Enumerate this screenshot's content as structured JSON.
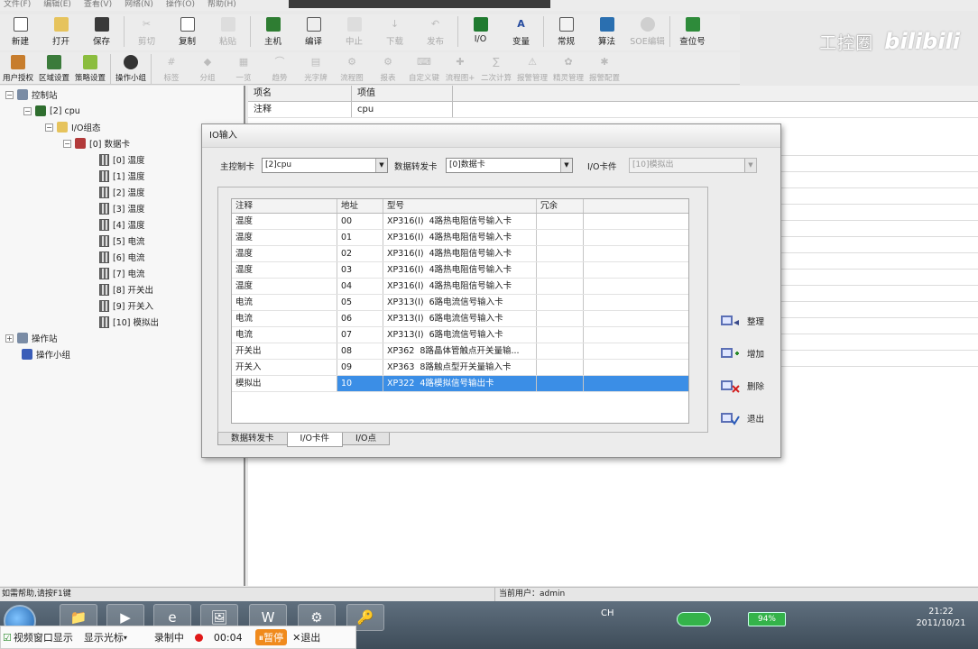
{
  "menubar": {
    "items": [
      "文件(F)",
      "编辑(E)",
      "查看(V)",
      "网络(N)",
      "操作(O)",
      "帮助(H)"
    ]
  },
  "toolbar1": [
    {
      "label": "新建",
      "icon": "new-file-icon",
      "enabled": true
    },
    {
      "label": "打开",
      "icon": "open-folder-icon",
      "enabled": true
    },
    {
      "label": "保存",
      "icon": "save-icon",
      "enabled": true
    },
    {
      "label": "剪切",
      "icon": "cut-icon",
      "enabled": false
    },
    {
      "label": "复制",
      "icon": "copy-icon",
      "enabled": true
    },
    {
      "label": "粘贴",
      "icon": "paste-icon",
      "enabled": false
    },
    {
      "label": "主机",
      "icon": "host-icon",
      "enabled": true
    },
    {
      "label": "编译",
      "icon": "compile-icon",
      "enabled": true
    },
    {
      "label": "中止",
      "icon": "stop-icon",
      "enabled": false
    },
    {
      "label": "下载",
      "icon": "download-icon",
      "enabled": false
    },
    {
      "label": "发布",
      "icon": "publish-icon",
      "enabled": false
    },
    {
      "label": "I/O",
      "icon": "io-icon",
      "enabled": true
    },
    {
      "label": "变量",
      "icon": "variable-icon",
      "enabled": true
    },
    {
      "label": "常规",
      "icon": "general-icon",
      "enabled": true
    },
    {
      "label": "算法",
      "icon": "algorithm-icon",
      "enabled": true
    },
    {
      "label": "SOE编辑",
      "icon": "soe-icon",
      "enabled": false
    },
    {
      "label": "查位号",
      "icon": "find-tag-icon",
      "enabled": true
    }
  ],
  "toolbar2": [
    {
      "label": "用户授权",
      "icon": "user-auth-icon",
      "enabled": true
    },
    {
      "label": "区域设置",
      "icon": "region-icon",
      "enabled": true
    },
    {
      "label": "策略设置",
      "icon": "policy-icon",
      "enabled": true
    },
    {
      "label": "操作小组",
      "icon": "operator-group-icon",
      "enabled": true
    },
    {
      "label": "标签",
      "icon": "tag-icon",
      "enabled": false
    },
    {
      "label": "分组",
      "icon": "group-icon",
      "enabled": false
    },
    {
      "label": "一览",
      "icon": "overview-icon",
      "enabled": false
    },
    {
      "label": "趋势",
      "icon": "trend-icon",
      "enabled": false
    },
    {
      "label": "光字牌",
      "icon": "annunciator-icon",
      "enabled": false
    },
    {
      "label": "流程图",
      "icon": "flowchart-icon",
      "enabled": false
    },
    {
      "label": "报表",
      "icon": "report-icon",
      "enabled": false
    },
    {
      "label": "自定义键",
      "icon": "custom-key-icon",
      "enabled": false
    },
    {
      "label": "流程图+",
      "icon": "flowchart-plus-icon",
      "enabled": false
    },
    {
      "label": "二次计算",
      "icon": "calc-icon",
      "enabled": false
    },
    {
      "label": "报警管理",
      "icon": "alarm-icon",
      "enabled": false
    },
    {
      "label": "精灵管理",
      "icon": "sprite-icon",
      "enabled": false
    },
    {
      "label": "报警配置",
      "icon": "alarm-config-icon",
      "enabled": false
    }
  ],
  "watermark": {
    "text1": "工控圈",
    "text2": "bilibili"
  },
  "tree": {
    "control_station": "控制站",
    "cpu": "[2] cpu",
    "io_group": "I/O组态",
    "data_card": "[0] 数据卡",
    "channels": [
      "[0] 温度",
      "[1] 温度",
      "[2] 温度",
      "[3] 温度",
      "[4] 温度",
      "[5] 电流",
      "[6] 电流",
      "[7] 电流",
      "[8] 开关出",
      "[9] 开关入",
      "[10] 模拟出"
    ],
    "operator_station": "操作站",
    "operator_group": "操作小组"
  },
  "grid": {
    "header": [
      "项名",
      "项值"
    ],
    "rows": [
      [
        "注释",
        "cpu"
      ]
    ]
  },
  "dialog": {
    "title": "IO输入",
    "master_label": "主控制卡",
    "master_value": "[2]cpu",
    "forwarder_label": "数据转发卡",
    "forwarder_value": "[0]数据卡",
    "iocard_label": "I/O卡件",
    "iocard_value": "[10]模拟出",
    "columns": [
      "注释",
      "地址",
      "型号",
      "冗余"
    ],
    "rows": [
      [
        "温度",
        "00",
        "XP316(I)",
        "4路热电阻信号输入卡"
      ],
      [
        "温度",
        "01",
        "XP316(I)",
        "4路热电阻信号输入卡"
      ],
      [
        "温度",
        "02",
        "XP316(I)",
        "4路热电阻信号输入卡"
      ],
      [
        "温度",
        "03",
        "XP316(I)",
        "4路热电阻信号输入卡"
      ],
      [
        "温度",
        "04",
        "XP316(I)",
        "4路热电阻信号输入卡"
      ],
      [
        "电流",
        "05",
        "XP313(I)",
        "6路电流信号输入卡"
      ],
      [
        "电流",
        "06",
        "XP313(I)",
        "6路电流信号输入卡"
      ],
      [
        "电流",
        "07",
        "XP313(I)",
        "6路电流信号输入卡"
      ],
      [
        "开关出",
        "08",
        "XP362",
        "8路晶体管触点开关量输..."
      ],
      [
        "开关入",
        "09",
        "XP363",
        "8路触点型开关量输入卡"
      ],
      [
        "模拟出",
        "10",
        "XP322",
        "4路模拟信号输出卡"
      ]
    ],
    "selected_row": 10,
    "tabs": [
      "数据转发卡",
      "I/O卡件",
      "I/O点"
    ],
    "active_tab": 1,
    "buttons": {
      "tidy": "整理",
      "add": "增加",
      "delete": "删除",
      "exit": "退出"
    }
  },
  "status": {
    "help": "如需帮助,请按F1键",
    "user": "当前用户：admin"
  },
  "taskbar": {
    "apps": [
      "📁",
      "▶",
      "e",
      "🖼",
      "W",
      "⚙",
      "🔑"
    ],
    "tray_text": "CH",
    "battery": "94%",
    "time": "21:22",
    "date": "2011/10/21"
  },
  "recorder": {
    "show_window": "视频窗口显示",
    "show_cursor": "显示光标",
    "recording": "录制中",
    "elapsed": "00:04",
    "pause": "暂停",
    "exit": "退出"
  },
  "colors": {
    "selection": "#3b8ee6",
    "battery": "#34b34a",
    "record": "#e01818"
  }
}
